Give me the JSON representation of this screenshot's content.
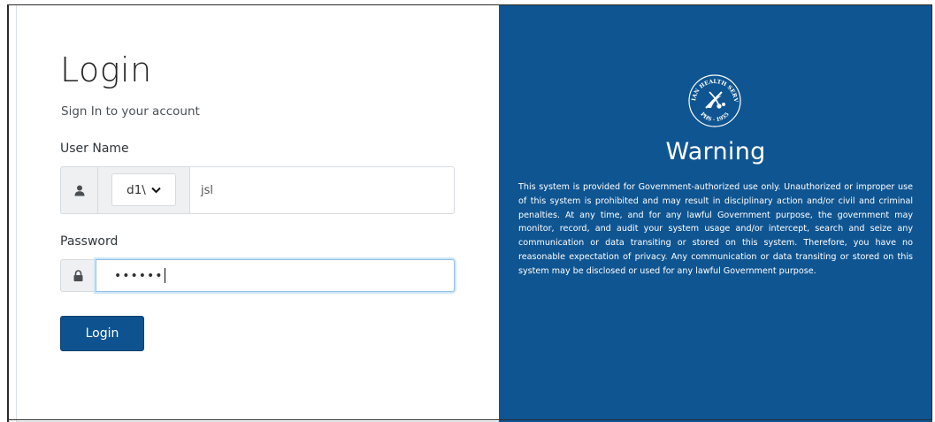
{
  "login": {
    "title": "Login",
    "subtitle": "Sign In to your account",
    "username": {
      "label": "User Name",
      "domain_selected": "d1\\",
      "value": "jsl"
    },
    "password": {
      "label": "Password",
      "value": "••••••"
    },
    "submit_label": "Login"
  },
  "warning": {
    "seal_text": "INDIAN HEALTH SERVICE · PHS · 1955",
    "title": "Warning",
    "text": "This system is provided for Government-authorized use only. Unauthorized or improper use of this system is prohibited and may result in disciplinary action and/or civil and criminal penalties. At any time, and for any lawful Government purpose, the government may monitor, record, and audit your system usage and/or intercept, search and seize any communication or data transiting or stored on this system. Therefore, you have no reasonable expectation of privacy. Any communication or data transiting or stored on this system may be disclosed or used for any lawful Government purpose."
  },
  "colors": {
    "brand_blue": "#0f5592",
    "button_blue": "#0e538f",
    "focus_border": "#8fc1e3"
  },
  "icons": {
    "username_addon": "user-icon",
    "password_addon": "lock-icon",
    "domain_dropdown": "chevron-down-icon",
    "seal": "ihs-seal-icon"
  }
}
